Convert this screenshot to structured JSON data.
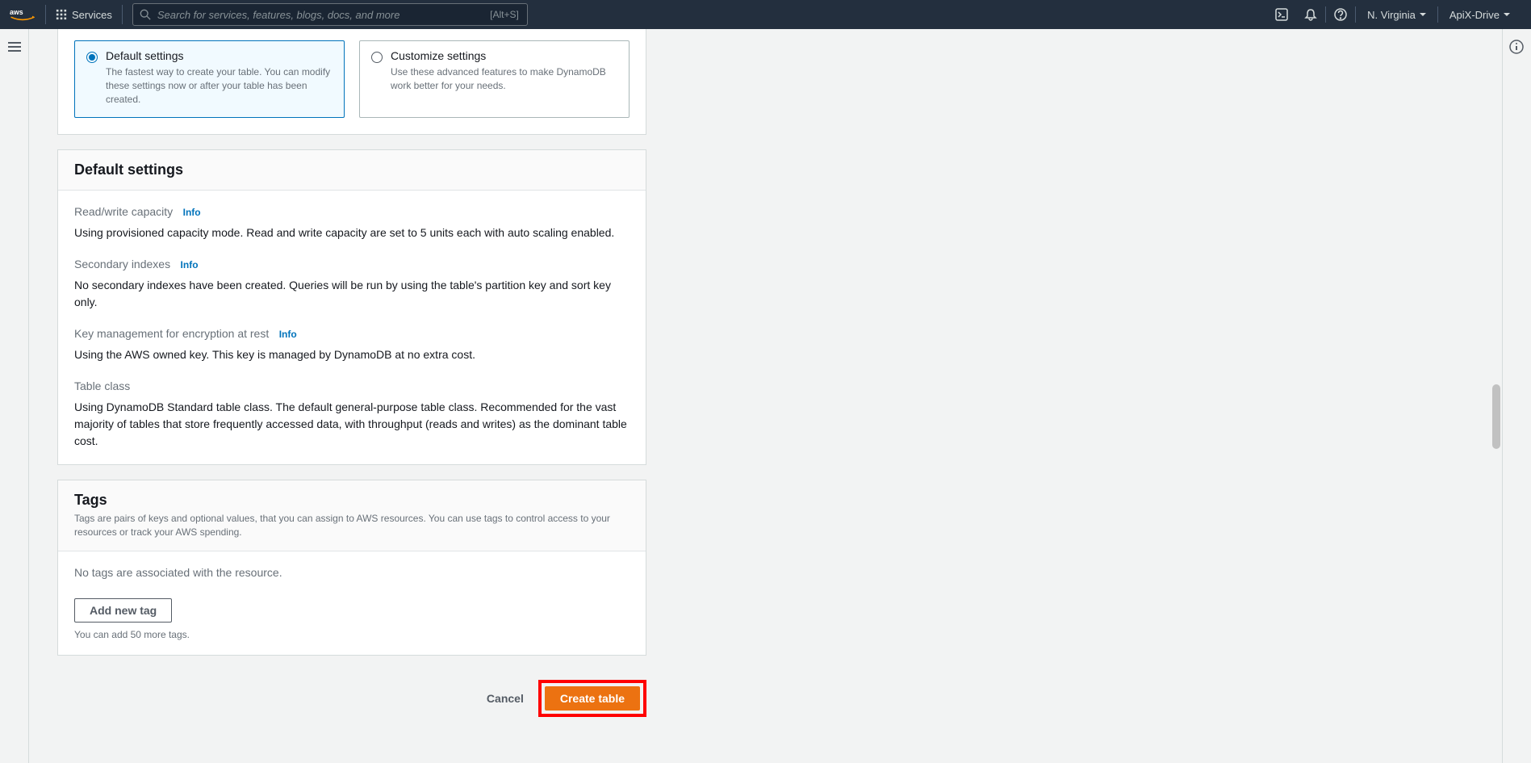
{
  "nav": {
    "services_label": "Services",
    "search_placeholder": "Search for services, features, blogs, docs, and more",
    "search_shortcut": "[Alt+S]",
    "region": "N. Virginia",
    "account": "ApiX-Drive"
  },
  "settings_cards": {
    "default": {
      "title": "Default settings",
      "desc": "The fastest way to create your table. You can modify these settings now or after your table has been created."
    },
    "custom": {
      "title": "Customize settings",
      "desc": "Use these advanced features to make DynamoDB work better for your needs."
    }
  },
  "default_panel": {
    "title": "Default settings",
    "info_label": "Info",
    "rw": {
      "label": "Read/write capacity",
      "value": "Using provisioned capacity mode. Read and write capacity are set to 5 units each with auto scaling enabled."
    },
    "si": {
      "label": "Secondary indexes",
      "value": "No secondary indexes have been created. Queries will be run by using the table's partition key and sort key only."
    },
    "km": {
      "label": "Key management for encryption at rest",
      "value": "Using the AWS owned key. This key is managed by DynamoDB at no extra cost."
    },
    "tc": {
      "label": "Table class",
      "value": "Using DynamoDB Standard table class. The default general-purpose table class. Recommended for the vast majority of tables that store frequently accessed data, with throughput (reads and writes) as the dominant table cost."
    }
  },
  "tags_panel": {
    "title": "Tags",
    "desc": "Tags are pairs of keys and optional values, that you can assign to AWS resources. You can use tags to control access to your resources or track your AWS spending.",
    "no_tags": "No tags are associated with the resource.",
    "add_btn": "Add new tag",
    "hint": "You can add 50 more tags."
  },
  "actions": {
    "cancel": "Cancel",
    "create": "Create table"
  }
}
